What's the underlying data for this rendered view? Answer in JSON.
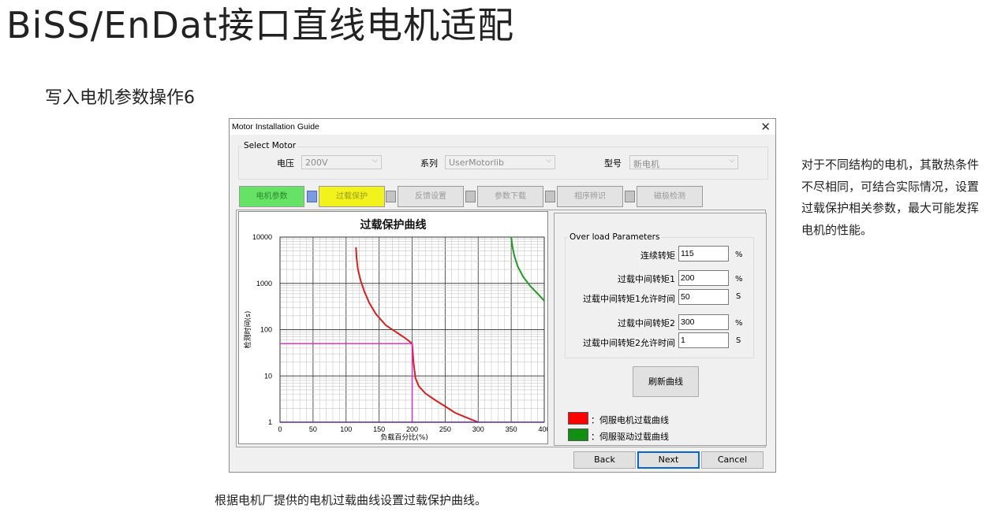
{
  "slide": {
    "title": "BiSS/EnDat接口直线电机适配",
    "subtitle": "写入电机参数操作6",
    "side_note": "对于不同结构的电机，其散热条件不尽相同，可结合实际情况，设置过载保护相关参数，最大可能发挥电机的性能。",
    "caption": "根据电机厂提供的电机过载曲线设置过载保护曲线。"
  },
  "window": {
    "title": "Motor Installation Guide",
    "close_glyph": "✕"
  },
  "select_motor": {
    "group_label": "Select Motor",
    "voltage_label": "电压",
    "voltage_value": "200V",
    "series_label": "系列",
    "series_value": "UserMotorlib",
    "model_label": "型号",
    "model_value": "新电机",
    "dropdown_glyph": "⌵"
  },
  "steps": [
    {
      "label": "电机参数",
      "state": "done"
    },
    {
      "label": "过载保护",
      "state": "active"
    },
    {
      "label": "反馈设置",
      "state": "disabled"
    },
    {
      "label": "参数下载",
      "state": "disabled"
    },
    {
      "label": "相序辨识",
      "state": "disabled"
    },
    {
      "label": "磁极检测",
      "state": "disabled"
    }
  ],
  "overload": {
    "group_label": "Over load Parameters",
    "continuous_label": "连续转矩",
    "continuous_value": "115",
    "mid1_label": "过载中间转矩1",
    "mid1_value": "200",
    "mid1_time_label": "过载中间转矩1允许时间",
    "mid1_time_value": "50",
    "mid2_label": "过载中间转矩2",
    "mid2_value": "300",
    "mid2_time_label": "过载中间转矩2允许时间",
    "mid2_time_value": "1",
    "unit_percent": "%",
    "unit_s": "S",
    "refresh_label": "刷新曲线"
  },
  "legend": {
    "motor_label": "：伺服电机过载曲线",
    "drive_label": "：伺服驱动过载曲线",
    "motor_color": "#ff0000",
    "drive_color": "#109010"
  },
  "buttons": {
    "back": "Back",
    "next": "Next",
    "cancel": "Cancel"
  },
  "chart_data": {
    "type": "line",
    "title": "过载保护曲线",
    "xlabel": "负载百分比(%)",
    "ylabel": "检测时间(s)",
    "xlim": [
      0,
      400
    ],
    "ylim": [
      1,
      10000
    ],
    "yscale": "log",
    "x_ticks": [
      0,
      50,
      100,
      150,
      200,
      250,
      300,
      350,
      400
    ],
    "y_ticks": [
      1,
      10,
      100,
      1000,
      10000
    ],
    "y_tick_labels": [
      "1",
      "10",
      "100",
      "1000",
      "10000"
    ],
    "grid": true,
    "series": [
      {
        "color": "#d62020",
        "x": [
          115,
          116,
          118,
          122,
          128,
          135,
          145,
          160,
          175,
          190,
          200,
          202,
          205,
          210,
          220,
          235,
          250,
          265,
          280,
          300
        ],
        "y": [
          6000,
          3500,
          2000,
          1150,
          650,
          380,
          220,
          125,
          90,
          65,
          50,
          20,
          9,
          6,
          4.2,
          3,
          2.2,
          1.6,
          1.3,
          1
        ]
      },
      {
        "color": "#229922",
        "x": [
          350,
          352,
          355,
          360,
          368,
          378,
          390,
          400
        ],
        "y": [
          10000,
          6000,
          3800,
          2300,
          1400,
          900,
          600,
          420
        ]
      },
      {
        "color": "#e020c8",
        "x": [
          0,
          200,
          200
        ],
        "y": [
          50,
          50,
          1
        ]
      },
      {
        "color": "#5a2aa0",
        "x": [
          0,
          400
        ],
        "y": [
          1,
          1
        ]
      }
    ]
  }
}
